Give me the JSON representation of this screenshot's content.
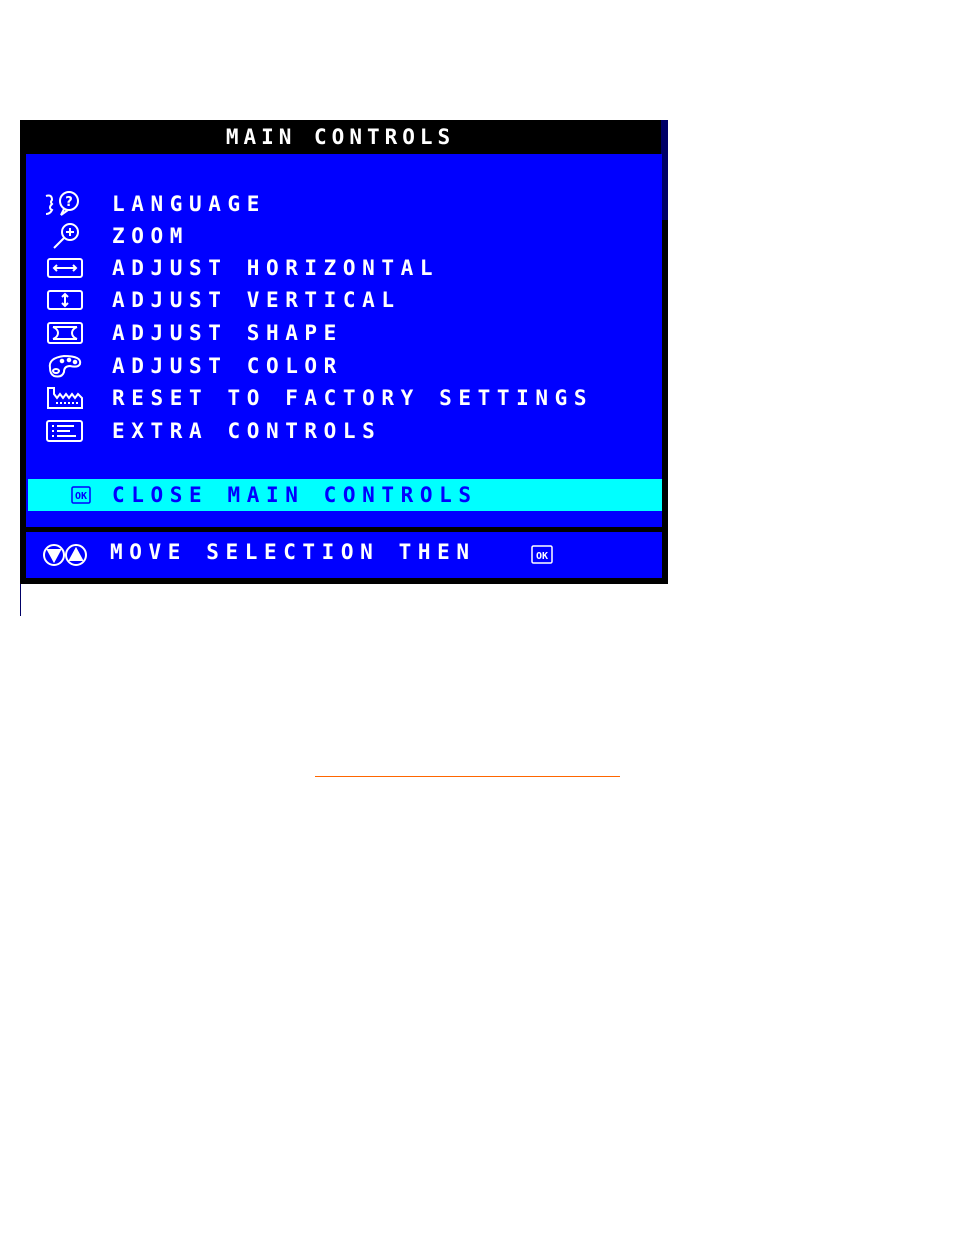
{
  "osd": {
    "title": "MAIN CONTROLS",
    "menu_items": [
      {
        "label": "LANGUAGE",
        "icon": "language-icon"
      },
      {
        "label": "ZOOM",
        "icon": "zoom-icon"
      },
      {
        "label": "ADJUST HORIZONTAL",
        "icon": "horizontal-arrows-icon"
      },
      {
        "label": "ADJUST VERTICAL",
        "icon": "vertical-arrows-icon"
      },
      {
        "label": "ADJUST SHAPE",
        "icon": "shape-icon"
      },
      {
        "label": "ADJUST COLOR",
        "icon": "palette-icon"
      },
      {
        "label": "RESET TO FACTORY SETTINGS",
        "icon": "factory-icon"
      },
      {
        "label": "EXTRA CONTROLS",
        "icon": "list-icon"
      }
    ],
    "selected_item": {
      "label": "CLOSE MAIN CONTROLS",
      "icon": "ok-icon"
    },
    "footer": {
      "label": "MOVE SELECTION THEN",
      "icon_left": "down-up-arrows-icon",
      "icon_right": "ok-icon"
    },
    "colors": {
      "background": "#0000ff",
      "highlight": "#00ffff",
      "text": "#ffffff",
      "frame": "#000000"
    }
  }
}
